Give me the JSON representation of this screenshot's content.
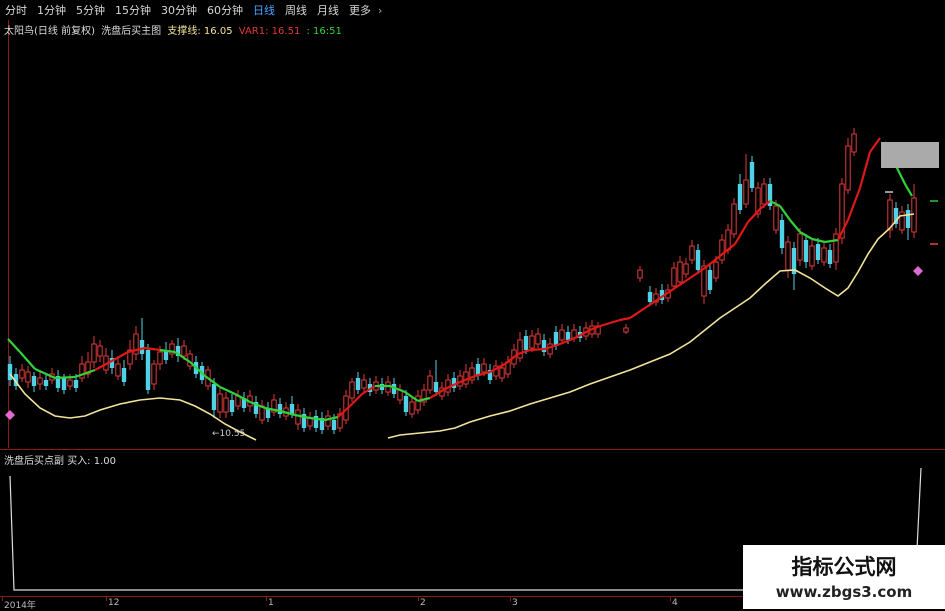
{
  "toolbar": {
    "periods": [
      "分时",
      "1分钟",
      "5分钟",
      "15分钟",
      "30分钟",
      "60分钟",
      "日线",
      "周线",
      "月线",
      "更多"
    ],
    "active": "日线",
    "active_color": "#4aa3ff"
  },
  "header": {
    "stock": "太阳鸟(日线 前复权)",
    "indicator": "洗盘后买主图",
    "support_label": "支撑线:",
    "support_value": "16.05",
    "var1_label": "VAR1:",
    "var1_value": "16.51",
    "third_value": ": 16:51"
  },
  "annotation": {
    "low_label": "←10.55"
  },
  "sub_header": {
    "name": "洗盘后买点副",
    "buy_label": "买入:",
    "buy_value": "1.00"
  },
  "xaxis": {
    "labels": [
      "2014年",
      "12",
      "1",
      "2",
      "3",
      "4"
    ]
  },
  "watermark": {
    "title": "指标公式网",
    "url": "www.zbgs3.com"
  },
  "colors": {
    "up": "#e03a3a",
    "down": "#4fd2e6",
    "ma_up": "#e01818",
    "ma_down": "#2fd33a",
    "support": "#f3e39a"
  }
}
